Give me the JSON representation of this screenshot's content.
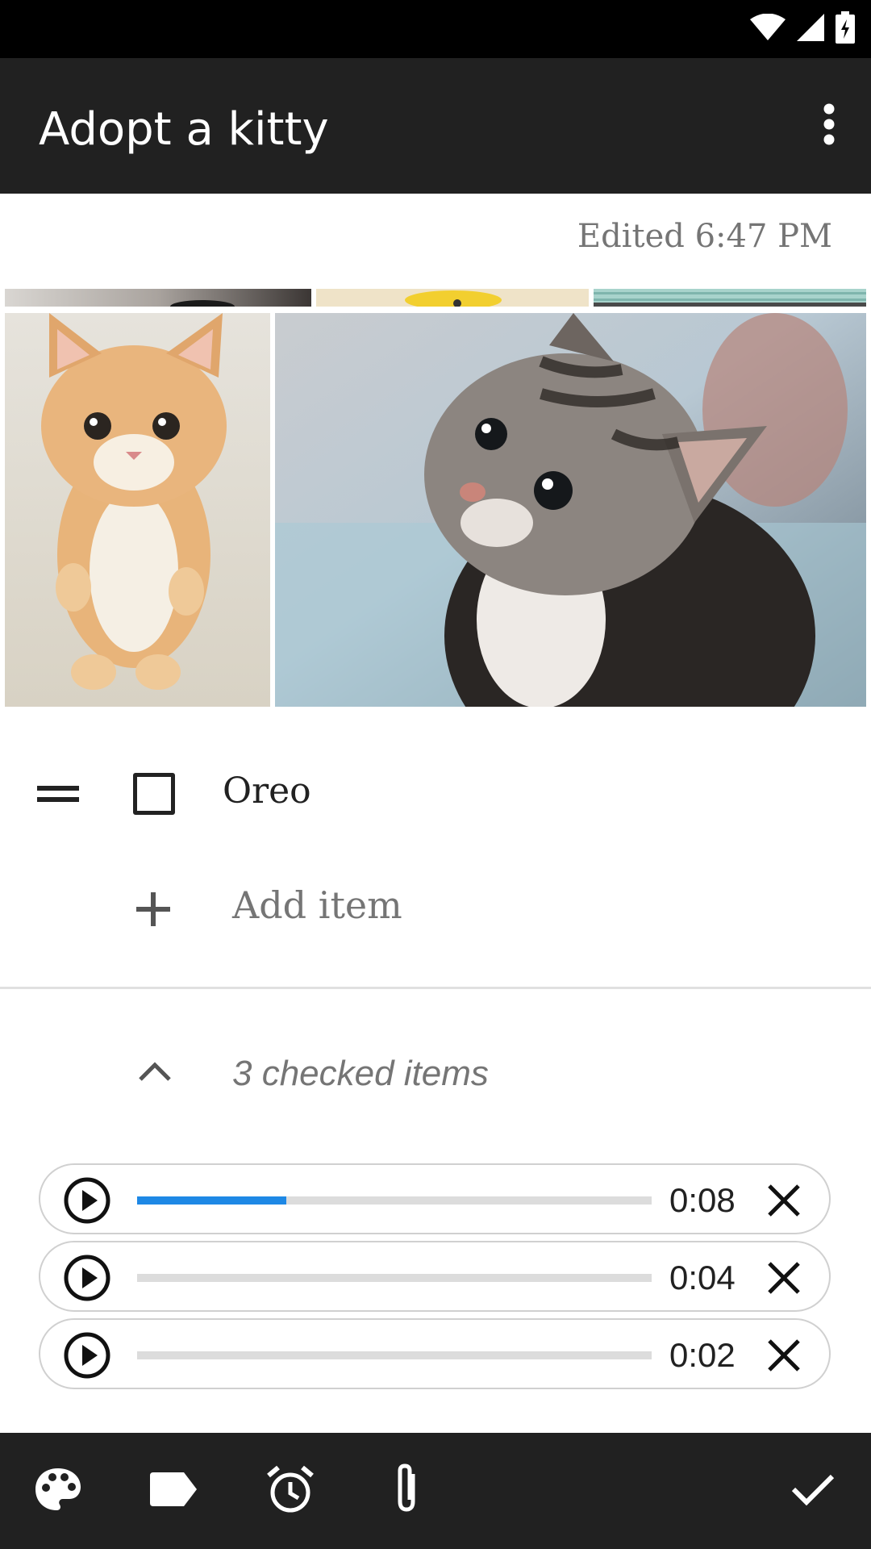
{
  "status_bar": {
    "icons": [
      "wifi-icon",
      "cell-signal-icon",
      "battery-charging-icon"
    ]
  },
  "app_bar": {
    "title": "Adopt a kitty",
    "overflow_icon": "more-vert-icon"
  },
  "note": {
    "edited_label": "Edited 6:47 PM"
  },
  "images": [
    "kitten-photo",
    "kitten-photo",
    "kitten-photo",
    "orange-kitten-photo",
    "tabby-kitten-photo"
  ],
  "list": {
    "items": [
      {
        "label": "Oreo",
        "checked": false
      }
    ],
    "add_item_label": "Add item",
    "checked_toggle_label": "3 checked items"
  },
  "recordings": [
    {
      "duration": "0:08",
      "progress": 0.29
    },
    {
      "duration": "0:04",
      "progress": 0
    },
    {
      "duration": "0:02",
      "progress": 0
    }
  ],
  "bottom_bar": {
    "icons": [
      "palette-icon",
      "label-icon",
      "alarm-icon",
      "attach-icon",
      "done-check-icon"
    ]
  },
  "colors": {
    "app_bar": "#212121",
    "progress_fill": "#1e88e5",
    "secondary_text": "#757575"
  }
}
